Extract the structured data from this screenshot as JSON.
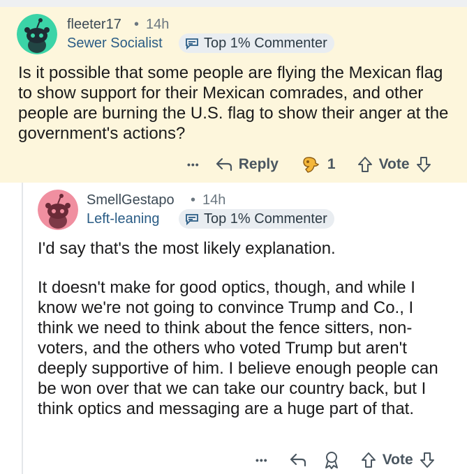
{
  "comments": [
    {
      "username": "fleeter17",
      "separator": "•",
      "time": "14h",
      "flair": "Sewer Socialist",
      "badge": "Top 1% Commenter",
      "body": "Is it possible that some people are flying the Mexican flag to show support for their Mexican comrades, and other people are burning the U.S. flag to show their anger at the government's actions?",
      "actions": {
        "more": "•••",
        "reply": "Reply",
        "award_count": "1",
        "vote": "Vote"
      },
      "colors": {
        "background": "#fdf6dc",
        "avatar": "#3bd4a7"
      }
    },
    {
      "username": "SmellGestapo",
      "separator": "•",
      "time": "14h",
      "flair": "Left-leaning",
      "badge": "Top 1% Commenter",
      "paragraphs": [
        "I'd say that's the most likely explanation.",
        "It doesn't make for good optics, though, and while I know we're not going to convince Trump and Co., I think we need to think about the fence sitters, non-voters, and the others who voted Trump but aren't deeply supportive of him. I believe enough people can be won over that we can take our country back, but I think optics and messaging are a huge part of that."
      ],
      "actions": {
        "more": "•••",
        "vote": "Vote"
      },
      "colors": {
        "background": "#ffffff",
        "avatar": "#f08fa0"
      }
    }
  ],
  "icons": {
    "more": "more-options-icon",
    "reply": "reply-arrow-icon",
    "award": "award-icon",
    "upvote": "upvote-arrow-icon",
    "downvote": "downvote-arrow-icon",
    "badge": "top-commenter-badge-icon"
  }
}
